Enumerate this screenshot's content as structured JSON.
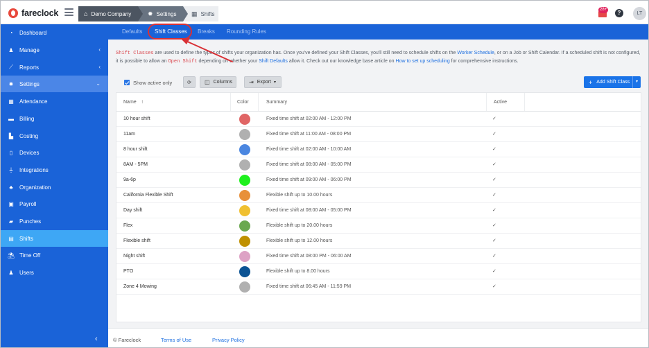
{
  "app": {
    "brand": "fareclock",
    "breadcrumbs": [
      {
        "label": "Demo Company",
        "icon": "home-icon"
      },
      {
        "label": "Settings",
        "icon": "gear-icon"
      },
      {
        "label": "Shifts",
        "icon": "calendar-icon"
      }
    ],
    "notification_count": "28+",
    "help": "?",
    "user_initials": "LT"
  },
  "sidebar": {
    "items": [
      {
        "label": "Dashboard",
        "icon": "dashboard-icon",
        "chevron": ""
      },
      {
        "label": "Manage",
        "icon": "person-icon",
        "chevron": "‹"
      },
      {
        "label": "Reports",
        "icon": "chart-icon",
        "chevron": "‹"
      },
      {
        "label": "Settings",
        "icon": "gear-icon",
        "chevron": "⌄"
      },
      {
        "label": "Attendance",
        "icon": "grid-icon",
        "chevron": ""
      },
      {
        "label": "Billing",
        "icon": "card-icon",
        "chevron": ""
      },
      {
        "label": "Costing",
        "icon": "bar-chart-icon",
        "chevron": ""
      },
      {
        "label": "Devices",
        "icon": "tablet-icon",
        "chevron": ""
      },
      {
        "label": "Integrations",
        "icon": "plug-icon",
        "chevron": ""
      },
      {
        "label": "Organization",
        "icon": "org-icon",
        "chevron": ""
      },
      {
        "label": "Payroll",
        "icon": "money-icon",
        "chevron": ""
      },
      {
        "label": "Punches",
        "icon": "punch-icon",
        "chevron": ""
      },
      {
        "label": "Shifts",
        "icon": "calendar-icon",
        "chevron": ""
      },
      {
        "label": "Time Off",
        "icon": "beach-icon",
        "chevron": ""
      },
      {
        "label": "Users",
        "icon": "users-icon",
        "chevron": ""
      }
    ],
    "collapse": "‹"
  },
  "subtabs": [
    "Defaults",
    "Shift Classes",
    "Breaks",
    "Rounding Rules"
  ],
  "intro": {
    "p1": "Shift Classes",
    "p2": " are used to define the types of shifts your organization has. Once you've defined your Shift Classes, you'll still need to schedule shifts on the ",
    "p3": "Worker Schedule",
    "p4": ", or on a Job or Shift Calendar. If a scheduled shift is not configured, it is possible to allow an ",
    "p5": "Open Shift",
    "p6": " depending on whether your ",
    "p7": "Shift Defaults",
    "p8": " allow it. Check out our knowledge base article on ",
    "p9": "How to set up scheduling",
    "p10": " for comprehensive instructions."
  },
  "toolbar": {
    "show_active": "Show active only",
    "refresh": "⟳",
    "columns": "Columns",
    "export": "Export",
    "add": "Add Shift Class"
  },
  "table": {
    "headers": {
      "name": "Name",
      "sort": "↑",
      "color": "Color",
      "summary": "Summary",
      "active": "Active"
    },
    "rows": [
      {
        "name": "10 hour shift",
        "color": "#e06565",
        "summary": "Fixed time shift at 02:00 AM - 12:00 PM",
        "active": "✓"
      },
      {
        "name": "11am",
        "color": "#b0b0b0",
        "summary": "Fixed time shift at 11:00 AM - 08:00 PM",
        "active": "✓"
      },
      {
        "name": "8 hour shift",
        "color": "#4a86e0",
        "summary": "Fixed time shift at 02:00 AM - 10:00 AM",
        "active": "✓"
      },
      {
        "name": "8AM - 5PM",
        "color": "#b0b0b0",
        "summary": "Fixed time shift at 08:00 AM - 05:00 PM",
        "active": "✓"
      },
      {
        "name": "9a-6p",
        "color": "#1ef01e",
        "summary": "Fixed time shift at 09:00 AM - 06:00 PM",
        "active": "✓"
      },
      {
        "name": "California Flexible Shift",
        "color": "#e8903a",
        "summary": "Flexible shift up to 10.00 hours",
        "active": "✓"
      },
      {
        "name": "Day shift",
        "color": "#f0c030",
        "summary": "Fixed time shift at 08:00 AM - 05:00 PM",
        "active": "✓"
      },
      {
        "name": "Flex",
        "color": "#6aa84f",
        "summary": "Flexible shift up to 20.00 hours",
        "active": "✓"
      },
      {
        "name": "Flexible shift",
        "color": "#bf9000",
        "summary": "Flexible shift up to 12.00 hours",
        "active": "✓"
      },
      {
        "name": "Night shift",
        "color": "#dda2c5",
        "summary": "Fixed time shift at 08:00 PM - 06:00 AM",
        "active": "✓"
      },
      {
        "name": "PTO",
        "color": "#0b5394",
        "summary": "Flexible shift up to 8.00 hours",
        "active": "✓"
      },
      {
        "name": "Zone 4 Mowing",
        "color": "#b0b0b0",
        "summary": "Fixed time shift at 06:45 AM - 11:59 PM",
        "active": "✓"
      }
    ]
  },
  "footer": {
    "copyright": "© Fareclock",
    "terms": "Terms of Use",
    "privacy": "Privacy Policy"
  },
  "colors": {
    "sidebar": "#1a63d8",
    "active_item": "#3ea7f5",
    "accent": "#1a73e8",
    "annotation": "#d93035"
  }
}
